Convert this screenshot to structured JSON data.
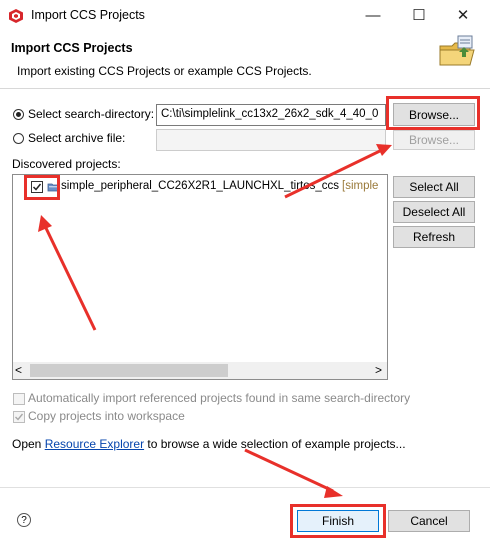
{
  "window": {
    "title": "Import CCS Projects",
    "minimize_glyph": "—",
    "maximize_glyph": "☐",
    "close_glyph": "✕"
  },
  "header": {
    "title": "Import CCS Projects",
    "subtitle": "Import existing CCS Projects or example CCS Projects.",
    "icon": "import-wizard-icon"
  },
  "source": {
    "search_directory_label": "Select search-directory:",
    "search_directory_value": "C:\\ti\\simplelink_cc13x2_26x2_sdk_4_40_0",
    "search_directory_selected": true,
    "browse_label": "Browse...",
    "archive_label": "Select archive file:",
    "archive_value": "",
    "archive_browse_label": "Browse..."
  },
  "projects": {
    "label": "Discovered projects:",
    "items": [
      {
        "name": "simple_peripheral_CC26X2R1_LAUNCHXL_tirtos_ccs",
        "suffix": "[simple",
        "checked": true
      }
    ],
    "select_all_label": "Select All",
    "deselect_all_label": "Deselect All",
    "refresh_label": "Refresh",
    "scroll_left": "<",
    "scroll_right": ">"
  },
  "options": {
    "auto_import_label": "Automatically import referenced projects found in same search-directory",
    "copy_label": "Copy projects into workspace"
  },
  "resource": {
    "prefix": "Open ",
    "link": "Resource Explorer",
    "suffix": " to browse a wide selection of example projects..."
  },
  "footer": {
    "help_glyph": "?",
    "finish_label": "Finish",
    "cancel_label": "Cancel"
  },
  "colors": {
    "annotation_red": "#e8302a",
    "link_blue": "#0645ad",
    "app_icon_red": "#d7262b"
  }
}
